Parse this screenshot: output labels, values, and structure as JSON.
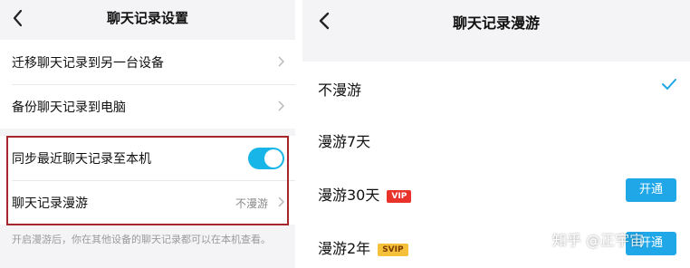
{
  "left_screen": {
    "title": "聊天记录设置",
    "rows": {
      "migrate": "迁移聊天记录到另一台设备",
      "backup": "备份聊天记录到电脑",
      "sync": "同步最近聊天记录至本机",
      "roaming": "聊天记录漫游",
      "roaming_value": "不漫游"
    },
    "sync_toggle_on": true,
    "note": "开启漫游后，你在其他设备的聊天记录都可以在本机查看。",
    "toggle_color": "#18b5e8",
    "highlight_color": "#a6262b"
  },
  "right_screen": {
    "title": "聊天记录漫游",
    "options": {
      "none": "不漫游",
      "days7": "漫游7天",
      "days30": "漫游30天",
      "years2": "漫游2年"
    },
    "badges": {
      "vip": "VIP",
      "svip": "SVIP"
    },
    "open_button": "开通",
    "selected": "不漫游",
    "accent_color": "#1fa7e8"
  },
  "watermark": "知乎 @正宇宙"
}
